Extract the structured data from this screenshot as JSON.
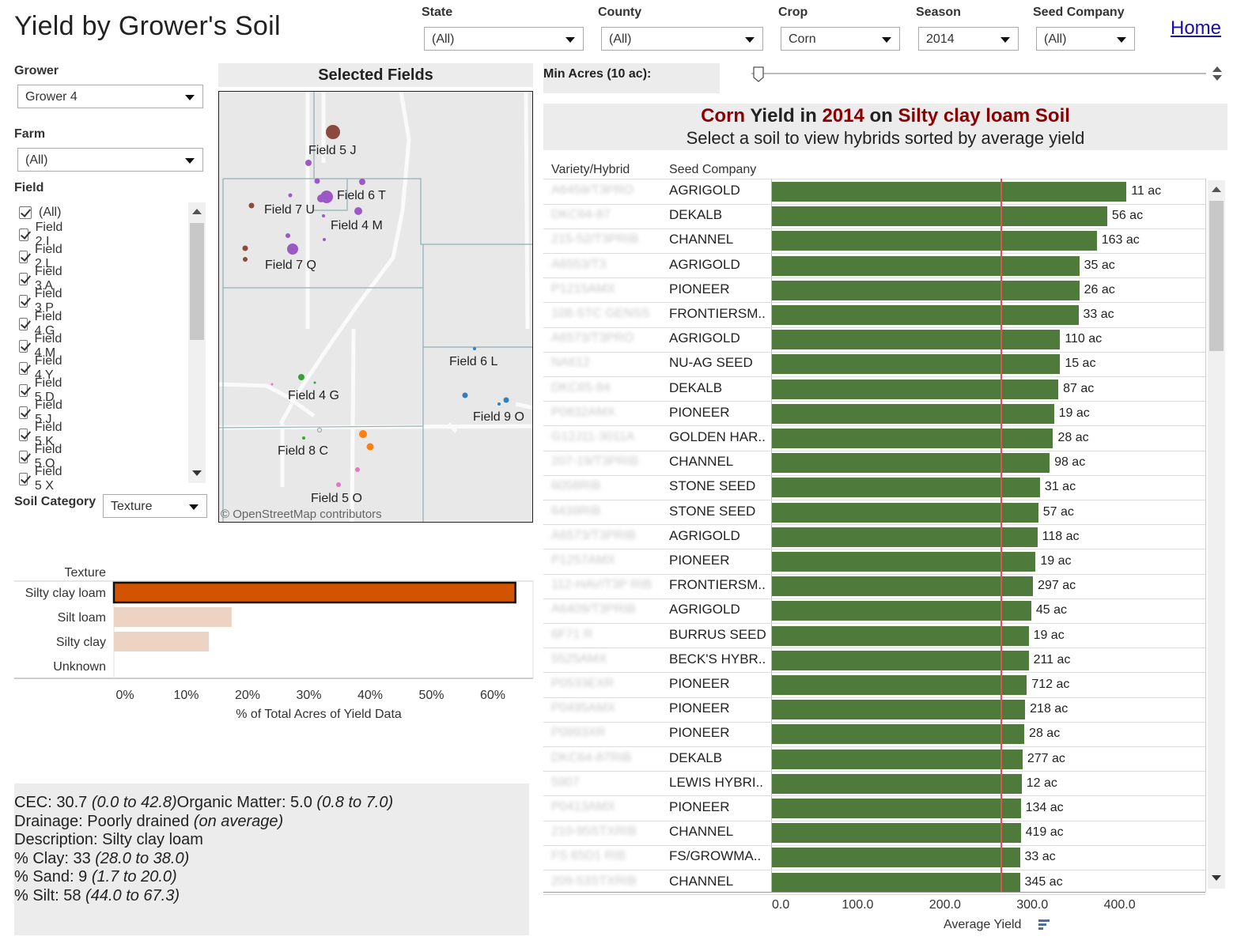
{
  "title": "Yield by Grower's Soil",
  "home_link": "Home",
  "filters": {
    "state": {
      "label": "State",
      "value": "(All)"
    },
    "county": {
      "label": "County",
      "value": "(All)"
    },
    "crop": {
      "label": "Crop",
      "value": "Corn"
    },
    "season": {
      "label": "Season",
      "value": "2014"
    },
    "seed_company": {
      "label": "Seed Company",
      "value": "(All)"
    }
  },
  "left_panel": {
    "grower": {
      "label": "Grower",
      "value": "Grower 4"
    },
    "farm": {
      "label": "Farm",
      "value": "(All)"
    },
    "field": {
      "label": "Field",
      "items": [
        "(All)",
        "Field 2 I",
        "Field 2 L",
        "Field 3 A",
        "Field 3 P",
        "Field 4 G",
        "Field 4 M",
        "Field 4 Y",
        "Field 5 D",
        "Field 5 J",
        "Field 5 K",
        "Field 5 O",
        "Field 5 X"
      ]
    },
    "soil_category": {
      "label": "Soil Category",
      "value": "Texture"
    }
  },
  "map": {
    "title": "Selected Fields",
    "attribution": "© OpenStreetMap contributors",
    "labels": [
      "Field 5 J",
      "Field 6 T",
      "Field 7 U",
      "Field 4 M",
      "Field 7 Q",
      "Field 6 L",
      "Field 4 G",
      "Field 9 O",
      "Field 8 C",
      "Field 5 O"
    ]
  },
  "texture_chart": {
    "chart_data": {
      "type": "bar",
      "orientation": "horizontal",
      "title": "Texture",
      "categories": [
        "Silty clay loam",
        "Silt loam",
        "Silty clay",
        "Unknown"
      ],
      "values": [
        65.5,
        19.2,
        15.5,
        0
      ],
      "selected": "Silty clay loam",
      "xlabel": "% of Total Acres of Yield Data",
      "xticks": [
        "0%",
        "10%",
        "20%",
        "30%",
        "40%",
        "50%",
        "60%"
      ],
      "xlim": [
        0,
        68
      ],
      "colors": {
        "selected": "#d35400",
        "other": "#ecd3c3"
      }
    }
  },
  "soil_info": {
    "cec_label": "CEC: 30.7 ",
    "cec_range": "(0.0 to 42.8)",
    "om_label": "Organic Matter: 5.0 ",
    "om_range": "(0.8 to 7.0)",
    "drainage_label": "Drainage: Poorly drained ",
    "drainage_note": "(on average)",
    "description": "Description: Silty clay loam",
    "clay_label": "% Clay: 33 ",
    "clay_range": "(28.0 to 38.0)",
    "sand_label": "% Sand: 9 ",
    "sand_range": "(1.7 to 20.0)",
    "silt_label": "% Silt: 58 ",
    "silt_range": "(44.0 to 67.3)"
  },
  "min_acres": {
    "label": "Min Acres (10 ac):"
  },
  "yield_header": {
    "w_crop": "Corn",
    "w_yield_in": " Yield in ",
    "w_year": "2014",
    "w_on": " on ",
    "w_soil": "Silty clay loam Soil",
    "subtitle": "Select a soil to view hybrids sorted by average yield"
  },
  "yield_table": {
    "col_variety": "Variety/Hybrid",
    "col_company": "Seed Company",
    "chart_data": {
      "type": "bar",
      "orientation": "horizontal",
      "xlabel": "Average Yield",
      "xticks": [
        "0.0",
        "100.0",
        "200.0",
        "300.0",
        "400.0"
      ],
      "xlim": [
        0,
        420
      ],
      "reference_line": 262,
      "bar_color": "#4e7a3b",
      "rows": [
        {
          "variety": "A6459/T3PRO",
          "company": "AGRIGOLD",
          "value": 406,
          "acres": "11 ac"
        },
        {
          "variety": "DKC64-87",
          "company": "DEKALB",
          "value": 384,
          "acres": "56 ac"
        },
        {
          "variety": "215-52/T3PRIB",
          "company": "CHANNEL",
          "value": 372,
          "acres": "163 ac"
        },
        {
          "variety": "A6553/T3",
          "company": "AGRIGOLD",
          "value": 352,
          "acres": "35 ac"
        },
        {
          "variety": "P1215AMX",
          "company": "PIONEER",
          "value": 352,
          "acres": "26 ac"
        },
        {
          "variety": "108-STC GENSS",
          "company": "FRONTIERSM..",
          "value": 351,
          "acres": "33 ac"
        },
        {
          "variety": "A6573/T3PRO",
          "company": "AGRIGOLD",
          "value": 330,
          "acres": "110 ac"
        },
        {
          "variety": "NA612",
          "company": "NU-AG SEED",
          "value": 330,
          "acres": "15 ac"
        },
        {
          "variety": "DKC65-84",
          "company": "DEKALB",
          "value": 328,
          "acres": "87 ac"
        },
        {
          "variety": "P0832AMX",
          "company": "PIONEER",
          "value": 323,
          "acres": "19 ac"
        },
        {
          "variety": "G12J11-3011A",
          "company": "GOLDEN HAR..",
          "value": 322,
          "acres": "28 ac"
        },
        {
          "variety": "207-19/T3PRIB",
          "company": "CHANNEL",
          "value": 318,
          "acres": "98 ac"
        },
        {
          "variety": "6058RIB",
          "company": "STONE SEED",
          "value": 307,
          "acres": "31 ac"
        },
        {
          "variety": "6439RIB",
          "company": "STONE SEED",
          "value": 305,
          "acres": "57 ac"
        },
        {
          "variety": "A6573/T3PRIB",
          "company": "AGRIGOLD",
          "value": 304,
          "acres": "118 ac"
        },
        {
          "variety": "P1257AMX",
          "company": "PIONEER",
          "value": 302,
          "acres": "19 ac"
        },
        {
          "variety": "112-HAV/T3P RIB",
          "company": "FRONTIERSM..",
          "value": 299,
          "acres": "297 ac"
        },
        {
          "variety": "A6409/T3PRIB",
          "company": "AGRIGOLD",
          "value": 297,
          "acres": "45 ac"
        },
        {
          "variety": "6F71 R",
          "company": "BURRUS SEED",
          "value": 294,
          "acres": "19 ac"
        },
        {
          "variety": "5525AMX",
          "company": "BECK'S HYBR..",
          "value": 294,
          "acres": "211 ac"
        },
        {
          "variety": "P0533EXR",
          "company": "PIONEER",
          "value": 292,
          "acres": "712 ac"
        },
        {
          "variety": "P0495AMX",
          "company": "PIONEER",
          "value": 290,
          "acres": "218 ac"
        },
        {
          "variety": "P0993XR",
          "company": "PIONEER",
          "value": 289,
          "acres": "28 ac"
        },
        {
          "variety": "DKC64-87RIB",
          "company": "DEKALB",
          "value": 287,
          "acres": "277 ac"
        },
        {
          "variety": "5907",
          "company": "LEWIS HYBRI..",
          "value": 286,
          "acres": "12 ac"
        },
        {
          "variety": "P0413AMX",
          "company": "PIONEER",
          "value": 285,
          "acres": "134 ac"
        },
        {
          "variety": "210-95STXRIB",
          "company": "CHANNEL",
          "value": 285,
          "acres": "419 ac"
        },
        {
          "variety": "FS 65D1 RIB",
          "company": "FS/GROWMA..",
          "value": 284,
          "acres": "33 ac"
        },
        {
          "variety": "209-53STXRIB",
          "company": "CHANNEL",
          "value": 284,
          "acres": "345 ac"
        }
      ]
    }
  }
}
